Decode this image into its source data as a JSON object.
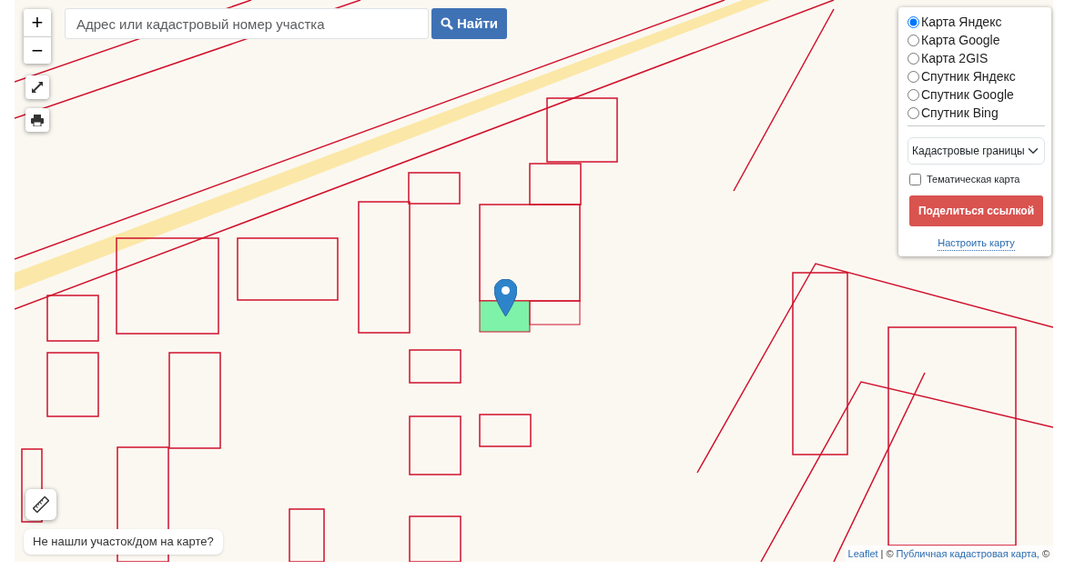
{
  "zoom_controls": {
    "zoom_in": "+",
    "zoom_out": "−"
  },
  "search": {
    "placeholder": "Адрес или кадастровый номер участка",
    "button": "Найти"
  },
  "layers": [
    {
      "label": "Карта Яндекс",
      "selected": true
    },
    {
      "label": "Карта Google",
      "selected": false
    },
    {
      "label": "Карта 2GIS",
      "selected": false
    },
    {
      "label": "Спутник Яндекс",
      "selected": false
    },
    {
      "label": "Спутник Google",
      "selected": false
    },
    {
      "label": "Спутник Bing",
      "selected": false
    }
  ],
  "overlay_select": {
    "value": "Кадастровые границы"
  },
  "thematic_map": {
    "label": "Тематическая карта",
    "checked": false
  },
  "share_button": "Поделиться ссылкой",
  "settings_link": "Настроить карту",
  "help_text": "Не нашли участок/дом на карте?",
  "attribution": {
    "leaflet": "Leaflet",
    "separator": "|",
    "copyright_1": "©",
    "source": "Публичная кадастровая карта,",
    "copyright_2": "©"
  }
}
